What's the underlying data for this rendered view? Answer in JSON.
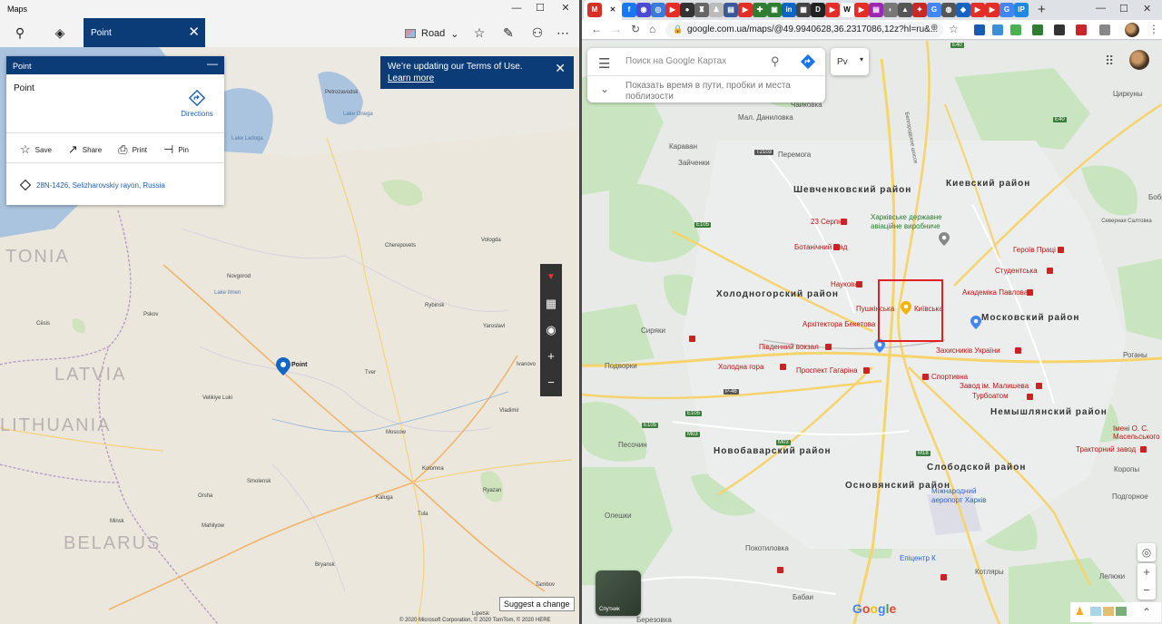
{
  "winmaps": {
    "title": "Maps",
    "controls": {
      "minimize": "—",
      "maximize": "☐",
      "close": "✕"
    },
    "tab_label": "Point",
    "tab_close": "✕",
    "style_label": "Road",
    "card": {
      "header": "Point",
      "collapse": "—",
      "name": "Point",
      "directions": "Directions",
      "actions": [
        {
          "icon": "☆",
          "label": "Save"
        },
        {
          "icon": "↗",
          "label": "Share"
        },
        {
          "icon": "⎙",
          "label": "Print"
        },
        {
          "icon": "⊣",
          "label": "Pin"
        }
      ],
      "address": "28N-1426, Selizharovskiy rayon, Russia"
    },
    "notice": {
      "line1": "We’re updating our Terms of Use.",
      "link": "Learn more",
      "close": "✕"
    },
    "map_labels": [
      {
        "text": "Petrozavodsk"
      },
      {
        "text": "Lake Onega"
      },
      {
        "text": "Lake Ladoga"
      },
      {
        "text": "Cherepovets"
      },
      {
        "text": "Vologda"
      },
      {
        "text": "Novgorod"
      },
      {
        "text": "Lake Ilmen"
      },
      {
        "text": "Rybinsk"
      },
      {
        "text": "Yaroslavl"
      },
      {
        "text": "Pskov"
      },
      {
        "text": "Ivanovo"
      },
      {
        "text": "Tver"
      },
      {
        "text": "Velikiye Luki"
      },
      {
        "text": "Vladimir"
      },
      {
        "text": "Moscow"
      },
      {
        "text": "Smolensk"
      },
      {
        "text": "Kolomna"
      },
      {
        "text": "Ryazan"
      },
      {
        "text": "Kaluga"
      },
      {
        "text": "Tula"
      },
      {
        "text": "Orsha"
      },
      {
        "text": "Minsk"
      },
      {
        "text": "Mahilyow"
      },
      {
        "text": "Bryansk"
      },
      {
        "text": "Tambov"
      },
      {
        "text": "Cēsis"
      },
      {
        "text": "Lipetsk"
      }
    ],
    "map_big_labels": [
      {
        "text": "TONIA"
      },
      {
        "text": "LATVIA"
      },
      {
        "text": "BELARUS"
      },
      {
        "text": "LITHUANIA"
      }
    ],
    "pin_label": "Point",
    "suggest": "Suggest a change",
    "copyright": "© 2020 Microsoft Corporation, © 2020 TomTom, © 2020 HERE"
  },
  "chrome": {
    "new_tab": "+",
    "window_controls": {
      "minimize": "—",
      "maximize": "☐",
      "close": "✕"
    },
    "url": "google.com.ua/maps/@49.9940628,36.2317086,12z?hl=ru&...",
    "search": {
      "placeholder": "Поиск на Google Картах",
      "hint": "Показать время в пути, пробки и места поблизости"
    },
    "lang": "Рv",
    "satellite_label": "Спутник",
    "google": "Google",
    "labels": [
      {
        "text": "Чайковка"
      },
      {
        "text": "Мал. Даниловка"
      },
      {
        "text": "Караван"
      },
      {
        "text": "Зайченки"
      },
      {
        "text": "Перемога"
      },
      {
        "text": "Шевченковский район",
        "cls": "dist"
      },
      {
        "text": "Киевский район",
        "cls": "dist"
      },
      {
        "text": "23 Серпня",
        "cls": "metro"
      },
      {
        "text": "Харківське державне авіаційне виробниче",
        "cls": "green"
      },
      {
        "text": "Ботанічний Сад",
        "cls": "metro"
      },
      {
        "text": "Героїв Праці",
        "cls": "metro"
      },
      {
        "text": "Студентська",
        "cls": "metro"
      },
      {
        "text": "Наукова",
        "cls": "metro"
      },
      {
        "text": "Академіка Павлова",
        "cls": "metro"
      },
      {
        "text": "Холодногорский район",
        "cls": "dist"
      },
      {
        "text": "Пушкінська",
        "cls": "metro"
      },
      {
        "text": "Київська",
        "cls": "metro"
      },
      {
        "text": "Архітектора Бекетова",
        "cls": "metro"
      },
      {
        "text": "Московский район",
        "cls": "dist"
      },
      {
        "text": "Сиряки"
      },
      {
        "text": "Південний вокзал",
        "cls": "metro"
      },
      {
        "text": "Захисників України",
        "cls": "metro"
      },
      {
        "text": "Подворки"
      },
      {
        "text": "Холодна гора",
        "cls": "metro"
      },
      {
        "text": "Проспект Гагаріна",
        "cls": "metro"
      },
      {
        "text": "Спортивна",
        "cls": "metro"
      },
      {
        "text": "Завод ім. Малишева",
        "cls": "metro"
      },
      {
        "text": "Турбоатом",
        "cls": "metro"
      },
      {
        "text": "Немышлянский район",
        "cls": "dist"
      },
      {
        "text": "Песочин"
      },
      {
        "text": "Новобаварский район",
        "cls": "dist"
      },
      {
        "text": "Слободской район",
        "cls": "dist"
      },
      {
        "text": "Імені О. С. Масельського",
        "cls": "metro"
      },
      {
        "text": "Тракторний завод",
        "cls": "metro"
      },
      {
        "text": "Основянский район",
        "cls": "dist"
      },
      {
        "text": "Міжнародний аеропорт Харків",
        "cls": "blue"
      },
      {
        "text": "Олешки"
      },
      {
        "text": "Покотиловка"
      },
      {
        "text": "Епіцентр К",
        "cls": "blue"
      },
      {
        "text": "Котляры"
      },
      {
        "text": "Бабаи"
      },
      {
        "text": "Березовка"
      },
      {
        "text": "Циркуны"
      },
      {
        "text": "Северная Салтовка"
      },
      {
        "text": "Лелюки"
      },
      {
        "text": "Коропы"
      },
      {
        "text": "Роганы"
      },
      {
        "text": "Бобр"
      },
      {
        "text": "Подгорное"
      },
      {
        "text": "Белгородское шоссе"
      }
    ],
    "shields": [
      {
        "text": "E40"
      },
      {
        "text": "T2103"
      },
      {
        "text": "E105"
      },
      {
        "text": "E105"
      },
      {
        "text": "E105"
      },
      {
        "text": "P-46"
      },
      {
        "text": "M03"
      },
      {
        "text": "M03"
      },
      {
        "text": "M18"
      },
      {
        "text": "E40"
      }
    ]
  },
  "colors": {
    "win_accent": "#0c3c78",
    "metro": "#c22222",
    "highlight_box": "#e02020"
  }
}
